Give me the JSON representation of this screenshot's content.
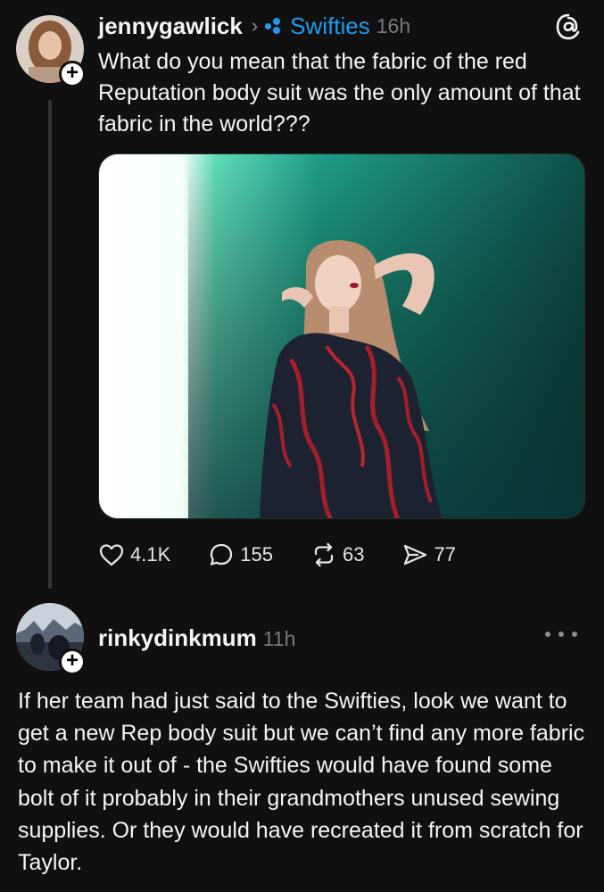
{
  "post1": {
    "username": "jennygawlick",
    "community": "Swifties",
    "time": "16h",
    "text": "What do you mean that the fabric of the red Reputation body suit was the only amount of that fabric in the world???",
    "actions": {
      "likes": "4.1K",
      "replies": "155",
      "reposts": "63",
      "shares": "77"
    }
  },
  "post2": {
    "username": "rinkydinkmum",
    "time": "11h",
    "text": "If her team had just said to the Swifties, look we want to get a new Rep body suit but we can’t find any more fabric to make it out of - the Swifties would have found some bolt of it probably in their grandmothers unused sewing supplies. Or they would have recreated it from scratch for Taylor."
  },
  "colors": {
    "background": "#101010",
    "community_accent": "#1d9bf0",
    "muted": "#777a7e"
  },
  "icons": {
    "follow": "plus-icon",
    "app": "threads-logo-icon",
    "like": "heart-icon",
    "reply": "comment-icon",
    "repost": "repost-icon",
    "share": "send-icon",
    "menu": "more-icon"
  }
}
